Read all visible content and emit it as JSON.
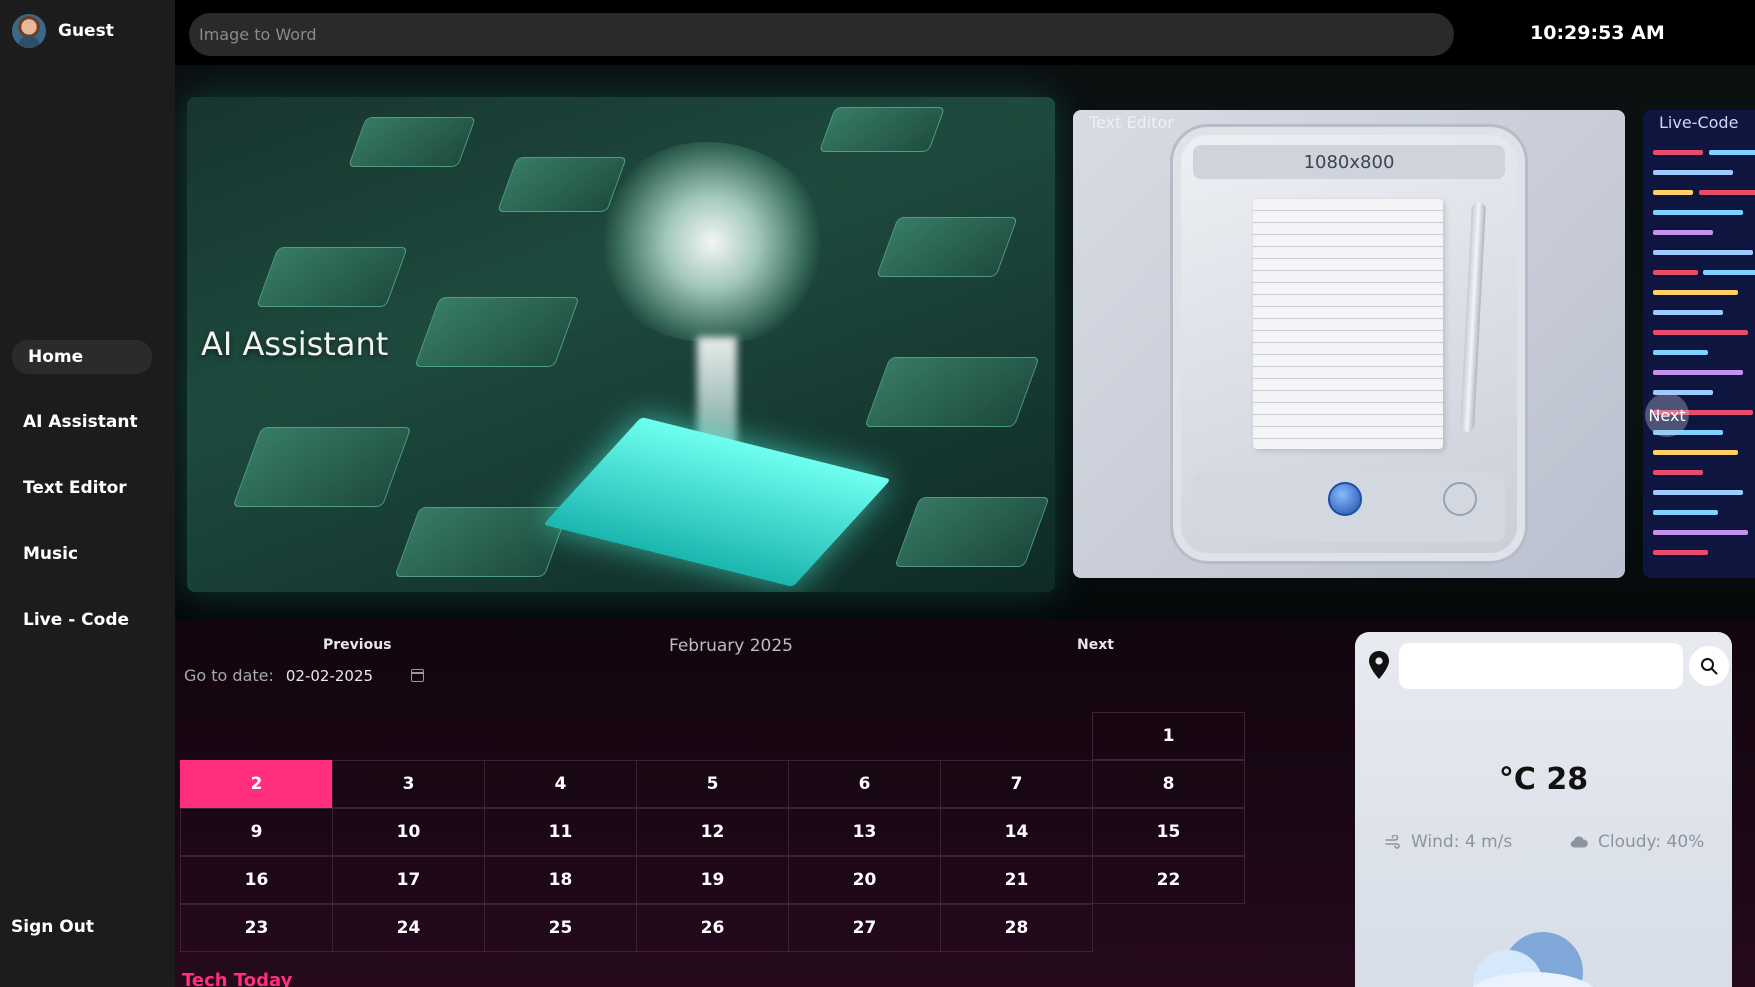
{
  "user": {
    "name": "Guest"
  },
  "nav": {
    "items": [
      {
        "label": "Home",
        "active": true
      },
      {
        "label": "AI Assistant",
        "active": false
      },
      {
        "label": "Text Editor",
        "active": false
      },
      {
        "label": "Music",
        "active": false
      },
      {
        "label": "Live - Code",
        "active": false
      }
    ],
    "sign_out": "Sign Out"
  },
  "topbar": {
    "search_placeholder": "Image to Word",
    "time": "10:29:53 AM"
  },
  "carousel": {
    "main_title": "AI Assistant",
    "editor_label": "Text Editor",
    "editor_dimensions": "1080x800",
    "code_label": "Live-Code",
    "next_label": "Next"
  },
  "calendar": {
    "prev_label": "Previous",
    "next_label": "Next",
    "month": "February 2025",
    "goto_label": "Go to date:",
    "goto_value": "02-02-2025",
    "today": 2,
    "weeks": [
      [
        "",
        "",
        "",
        "",
        "",
        "",
        "1"
      ],
      [
        "2",
        "3",
        "4",
        "5",
        "6",
        "7",
        "8"
      ],
      [
        "9",
        "10",
        "11",
        "12",
        "13",
        "14",
        "15"
      ],
      [
        "16",
        "17",
        "18",
        "19",
        "20",
        "21",
        "22"
      ],
      [
        "23",
        "24",
        "25",
        "26",
        "27",
        "28",
        ""
      ]
    ],
    "section_title": "Tech Today"
  },
  "weather": {
    "search_value": "",
    "temperature": "°C 28",
    "wind": "Wind: 4 m/s",
    "cloudy": "Cloudy: 40%"
  },
  "colors": {
    "accent": "#ff2f7d",
    "sidebar": "#1c1c1c"
  }
}
